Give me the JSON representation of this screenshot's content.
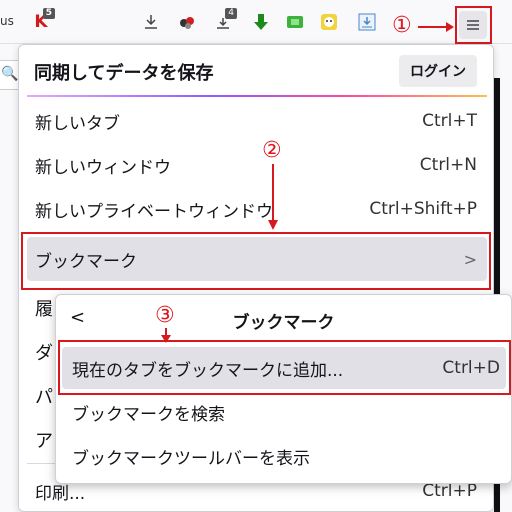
{
  "toolbar": {
    "left_text": "us",
    "badges": [
      "5",
      "4"
    ],
    "menu_icon": "hamburger-icon"
  },
  "annotations": {
    "step1": "①",
    "step2": "②",
    "step3": "③"
  },
  "panel": {
    "title": "同期してデータを保存",
    "login": "ログイン",
    "items": [
      {
        "label": "新しいタブ",
        "shortcut": "Ctrl+T"
      },
      {
        "label": "新しいウィンドウ",
        "shortcut": "Ctrl+N"
      },
      {
        "label": "新しいプライベートウィンドウ",
        "shortcut": "Ctrl+Shift+P"
      },
      {
        "label": "ブックマーク",
        "shortcut": ">"
      }
    ],
    "truncated": [
      "履",
      "ダ",
      "パ",
      "ア"
    ],
    "print": {
      "label": "印刷...",
      "shortcut": "Ctrl+P"
    }
  },
  "submenu": {
    "back": "<",
    "title": "ブックマーク",
    "items": [
      {
        "label": "現在のタブをブックマークに追加...",
        "shortcut": "Ctrl+D"
      },
      {
        "label": "ブックマークを検索",
        "shortcut": ""
      },
      {
        "label": "ブックマークツールバーを表示",
        "shortcut": ""
      }
    ]
  },
  "colors": {
    "annotation_red": "#d7191f",
    "highlight": "#e0e0e6"
  }
}
